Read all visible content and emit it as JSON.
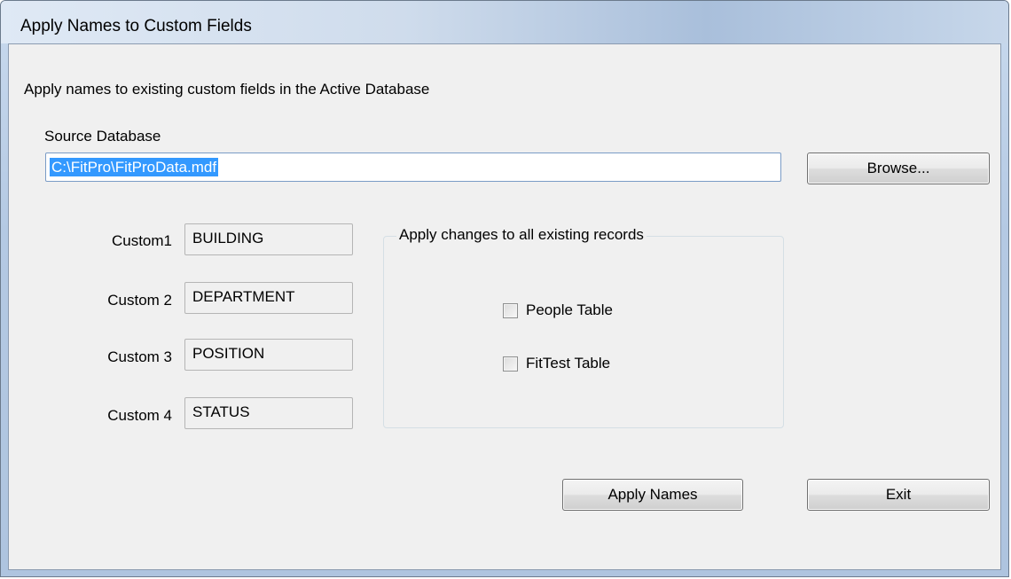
{
  "window": {
    "title": "Apply Names to Custom Fields"
  },
  "dialog": {
    "description": "Apply names to existing custom fields in the Active Database",
    "source_label": "Source Database",
    "source_path": "C:\\FitPro\\FitProData.mdf",
    "browse_label": "Browse..."
  },
  "custom_fields": [
    {
      "label": "Custom1",
      "value": "BUILDING"
    },
    {
      "label": "Custom 2",
      "value": "DEPARTMENT"
    },
    {
      "label": "Custom 3",
      "value": "POSITION"
    },
    {
      "label": "Custom 4",
      "value": "STATUS"
    }
  ],
  "apply_group": {
    "title": "Apply changes to all existing records",
    "options": [
      {
        "label": "People Table",
        "checked": false
      },
      {
        "label": "FitTest Table",
        "checked": false
      }
    ]
  },
  "buttons": {
    "apply_names": "Apply Names",
    "exit": "Exit"
  }
}
